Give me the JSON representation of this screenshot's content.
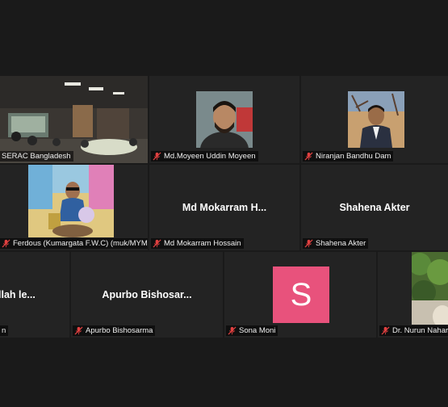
{
  "participants": {
    "serac": {
      "label": "SERAC Bangladesh"
    },
    "moyeen": {
      "label": "Md.Moyeen Uddin Moyeen"
    },
    "niranjan": {
      "label": "Niranjan Bandhu Dam"
    },
    "ferdous": {
      "label": "Ferdous (Kumargata F.W.C) (muk/MYM)"
    },
    "mokarram": {
      "display": "Md  Mokarram H...",
      "label": "Md Mokarram Hossain"
    },
    "shahena": {
      "display": "Shahena Akter",
      "label": "Shahena Akter"
    },
    "ullah": {
      "display": "llah le...",
      "label": "n"
    },
    "apurbo": {
      "display": "Apurbo  Bishosar...",
      "label": "Apurbo Bishosarma"
    },
    "sona": {
      "avatar_letter": "S",
      "label": "Sona Moni"
    },
    "nurun": {
      "label": "Dr. Nurun Nahar"
    }
  },
  "colors": {
    "active_border": "#c7e54a",
    "avatar_bg": "#e8527c",
    "mic_muted": "#e04040"
  }
}
